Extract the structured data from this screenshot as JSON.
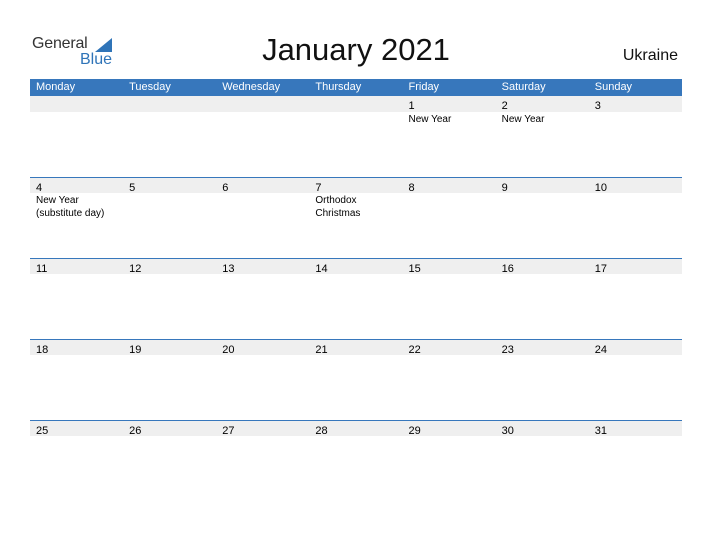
{
  "logo": {
    "general": "General",
    "blue": "Blue",
    "brand_color": "#2f74b8"
  },
  "title": "January 2021",
  "country": "Ukraine",
  "header_color": "#3777bc",
  "days": [
    "Monday",
    "Tuesday",
    "Wednesday",
    "Thursday",
    "Friday",
    "Saturday",
    "Sunday"
  ],
  "weeks": [
    {
      "dates": [
        "",
        "",
        "",
        "",
        "1",
        "2",
        "3"
      ],
      "events": [
        "",
        "",
        "",
        "",
        "New Year",
        "New Year",
        ""
      ]
    },
    {
      "dates": [
        "4",
        "5",
        "6",
        "7",
        "8",
        "9",
        "10"
      ],
      "events": [
        "New Year (substitute day)",
        "",
        "",
        "Orthodox Christmas",
        "",
        "",
        ""
      ]
    },
    {
      "dates": [
        "11",
        "12",
        "13",
        "14",
        "15",
        "16",
        "17"
      ],
      "events": [
        "",
        "",
        "",
        "",
        "",
        "",
        ""
      ]
    },
    {
      "dates": [
        "18",
        "19",
        "20",
        "21",
        "22",
        "23",
        "24"
      ],
      "events": [
        "",
        "",
        "",
        "",
        "",
        "",
        ""
      ]
    },
    {
      "dates": [
        "25",
        "26",
        "27",
        "28",
        "29",
        "30",
        "31"
      ],
      "events": [
        "",
        "",
        "",
        "",
        "",
        "",
        ""
      ]
    }
  ]
}
